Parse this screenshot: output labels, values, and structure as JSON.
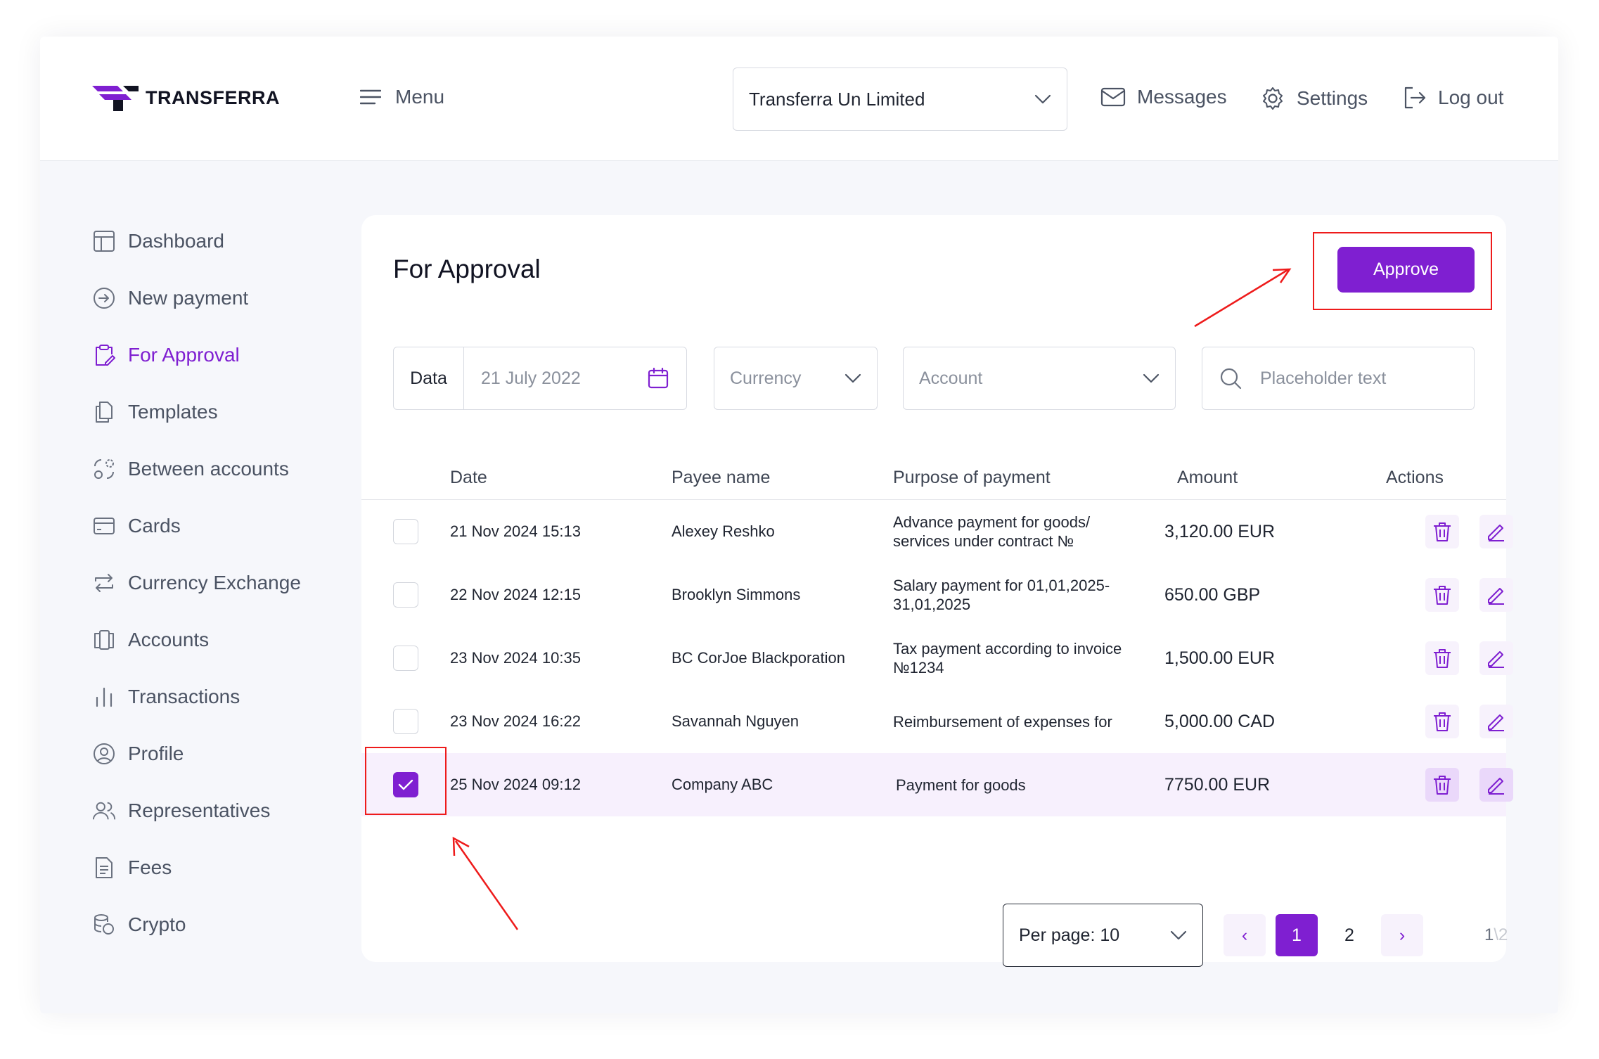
{
  "header": {
    "logo_text": "TRANSFERRA",
    "menu_label": "Menu",
    "company_select": "Transferra Un Limited",
    "nav": [
      {
        "label": "Messages",
        "icon": "mail-icon"
      },
      {
        "label": "Settings",
        "icon": "gear-icon"
      },
      {
        "label": "Log out",
        "icon": "logout-icon"
      }
    ]
  },
  "sidebar": {
    "active_index": 2,
    "items": [
      {
        "label": "Dashboard",
        "icon": "dashboard-icon"
      },
      {
        "label": "New payment",
        "icon": "arrow-circle-icon"
      },
      {
        "label": "For Approval",
        "icon": "clipboard-icon"
      },
      {
        "label": "Templates",
        "icon": "documents-icon"
      },
      {
        "label": "Between accounts",
        "icon": "transfer-icon"
      },
      {
        "label": "Cards",
        "icon": "card-icon"
      },
      {
        "label": "Currency Exchange",
        "icon": "exchange-icon"
      },
      {
        "label": "Accounts",
        "icon": "accounts-icon"
      },
      {
        "label": "Transactions",
        "icon": "bars-icon"
      },
      {
        "label": "Profile",
        "icon": "user-circle-icon"
      },
      {
        "label": "Representatives",
        "icon": "users-icon"
      },
      {
        "label": "Fees",
        "icon": "document-icon"
      },
      {
        "label": "Crypto",
        "icon": "coins-icon"
      }
    ]
  },
  "main": {
    "title": "For Approval",
    "approve_label": "Approve",
    "filters": {
      "date_label": "Data",
      "date_value": "21 July 2022",
      "currency_placeholder": "Currency",
      "account_placeholder": "Account",
      "search_placeholder": "Placeholder text"
    },
    "columns": [
      "Date",
      "Payee name",
      "Purpose of payment",
      "Amount",
      "Actions"
    ],
    "rows": [
      {
        "date": "21 Nov 2024  15:13",
        "payee": "Alexey Reshko",
        "purpose": "Advance payment for goods/ services under contract №",
        "amount": "3,120.00 EUR",
        "checked": false
      },
      {
        "date": "22 Nov 2024  12:15",
        "payee": "Brooklyn Simmons",
        "purpose": "Salary payment for 01,01,2025-31,01,2025",
        "amount": "650.00 GBP",
        "checked": false
      },
      {
        "date": "23 Nov 2024  10:35",
        "payee": "BC CorJoe Blackporation",
        "purpose": "Tax payment according to invoice №1234",
        "amount": "1,500.00 EUR",
        "checked": false
      },
      {
        "date": "23 Nov 2024  16:22",
        "payee": "Savannah Nguyen",
        "purpose": "Reimbursement of expenses for",
        "amount": "5,000.00 CAD",
        "checked": false
      },
      {
        "date": "25 Nov 2024  09:12",
        "payee": "Company ABC",
        "purpose": "Payment for goods",
        "amount": "7750.00 EUR",
        "checked": true
      }
    ],
    "pagination": {
      "per_page_label": "Per page: 10",
      "prev": "‹",
      "next": "›",
      "pages": [
        "1",
        "2"
      ],
      "current_page": "1",
      "info_current": "1",
      "info_sep": "\\",
      "info_total": "2"
    }
  },
  "colors": {
    "accent": "#7f1fd1",
    "annotation": "#ee1b1b"
  }
}
